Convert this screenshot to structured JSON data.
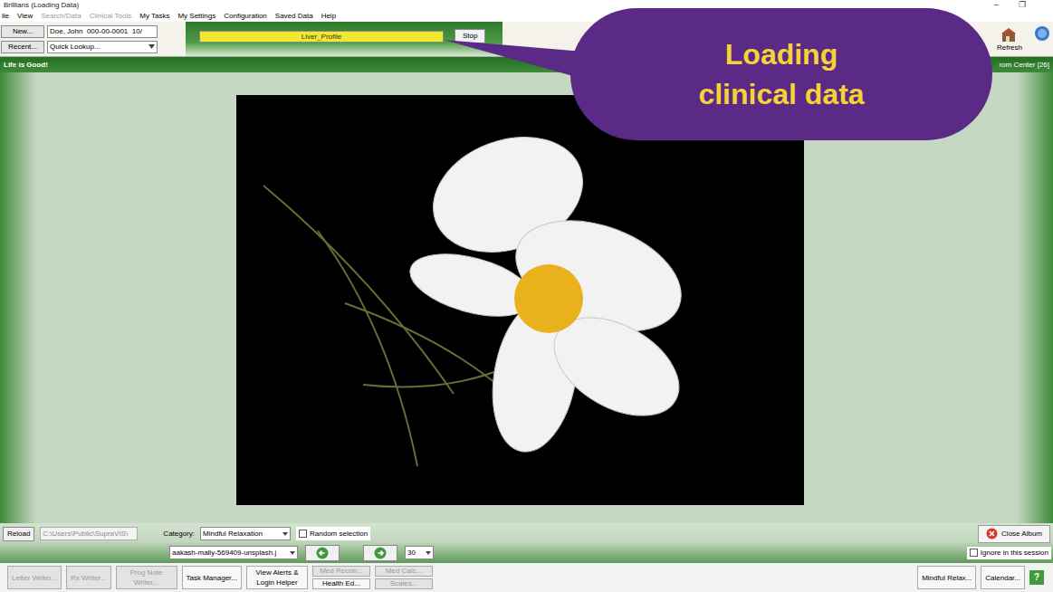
{
  "window": {
    "title": "Brillians (Loading Data)",
    "controls": [
      "–",
      "❐"
    ]
  },
  "menu": [
    {
      "label": "ile",
      "disabled": false
    },
    {
      "label": "View",
      "disabled": false
    },
    {
      "label": "Search/Data",
      "disabled": true
    },
    {
      "label": "Clinical Tools",
      "disabled": true
    },
    {
      "label": "My Tasks",
      "disabled": false
    },
    {
      "label": "My Settings",
      "disabled": false
    },
    {
      "label": "Configuration",
      "disabled": false
    },
    {
      "label": "Saved Data",
      "disabled": false
    },
    {
      "label": "Help",
      "disabled": false
    }
  ],
  "toolbar": {
    "new_button": "New...",
    "patient": "Doe, John  000-00-0001  10/",
    "recent_button": "Recent...",
    "quick_lookup": "Quick Lookup...",
    "progress": {
      "label": "Liver_Profile",
      "level": 1
    },
    "stop": "Stop",
    "refresh": "Refresh"
  },
  "banner": {
    "left": "Life is Good!",
    "right": "rom Center [26]"
  },
  "callout": {
    "text": "Loading clinical data"
  },
  "album": {
    "reload": "Reload",
    "path": "C:\\Users\\Public\\SupraVIS\\",
    "category_label": "Category:",
    "category": "Mindful Relaxation",
    "random": {
      "label": "Random selection",
      "checked": false
    },
    "file": "aakash-mally-569409-unsplash.j",
    "page_size": "30",
    "close": "Close Album",
    "ignore": {
      "label": "Ignore in this session",
      "checked": false
    }
  },
  "taskbar": {
    "left": [
      {
        "kind": "single",
        "label": "Letter Writer...",
        "disabled": true
      },
      {
        "kind": "single",
        "label": "Rx Writer...",
        "disabled": true
      },
      {
        "kind": "single",
        "label": "Prog Note Writer...",
        "disabled": true
      },
      {
        "kind": "single",
        "label": "Task Manager...",
        "disabled": false
      },
      {
        "kind": "single",
        "label": "View Alerts & Login Helper",
        "disabled": false
      },
      {
        "kind": "stack",
        "items": [
          {
            "label": "Med Recon...",
            "disabled": true
          },
          {
            "label": "Health Ed...",
            "disabled": false
          }
        ]
      },
      {
        "kind": "stack",
        "items": [
          {
            "label": "Med Calc...",
            "disabled": true
          },
          {
            "label": "Scales...",
            "disabled": true
          }
        ]
      }
    ],
    "right": [
      {
        "label": "Mindful Relax..."
      },
      {
        "label": "Calendar..."
      }
    ],
    "help": "?"
  }
}
